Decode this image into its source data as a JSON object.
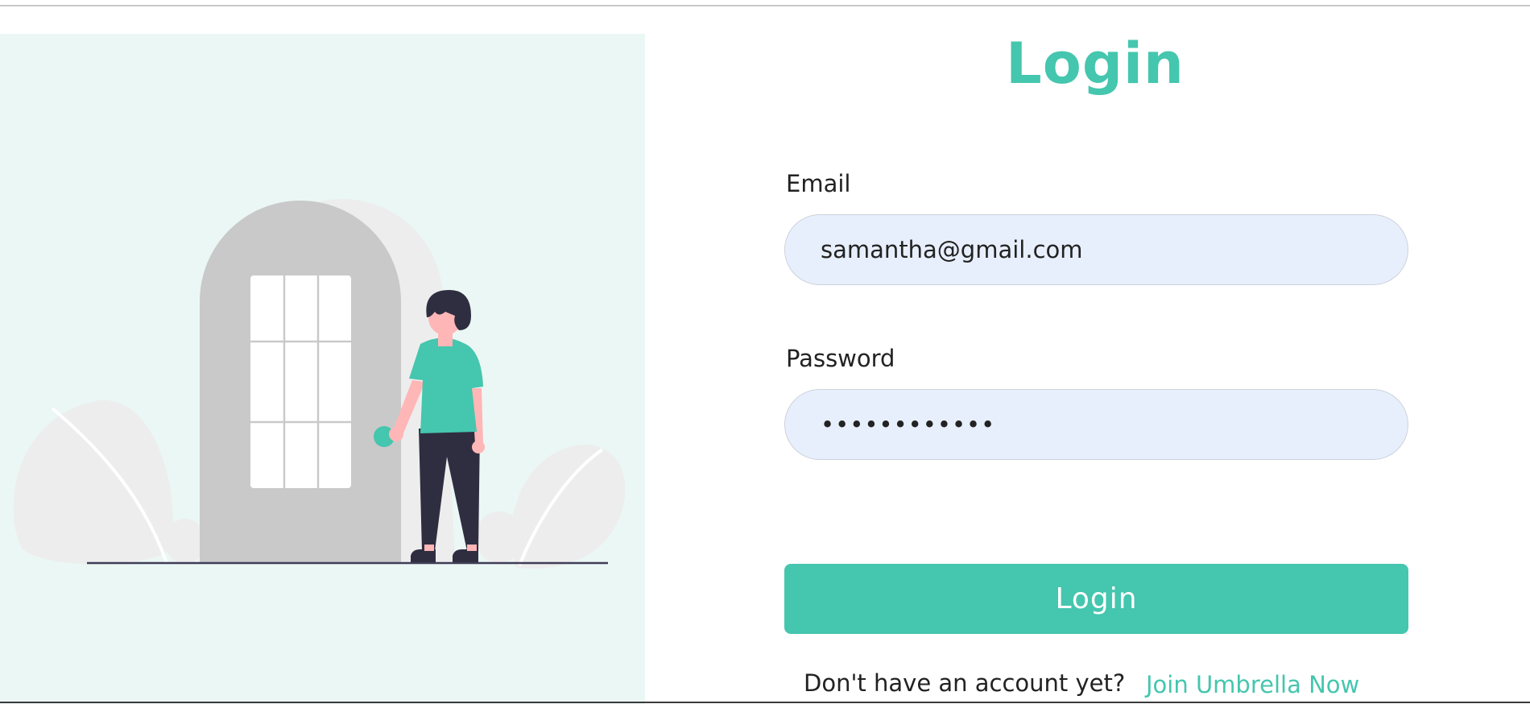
{
  "theme": {
    "accent": "#45c6ae",
    "illustration_background": "#ebf7f4",
    "input_background": "#e8effc"
  },
  "illustration": {
    "icon": "person-at-door-illustration"
  },
  "form": {
    "title": "Login",
    "email": {
      "label": "Email",
      "value": "samantha@gmail.com"
    },
    "password": {
      "label": "Password",
      "value": "••••••••••••"
    },
    "submit_label": "Login",
    "signup_prompt": "Don't have an account yet?",
    "signup_link": "Join Umbrella Now"
  }
}
